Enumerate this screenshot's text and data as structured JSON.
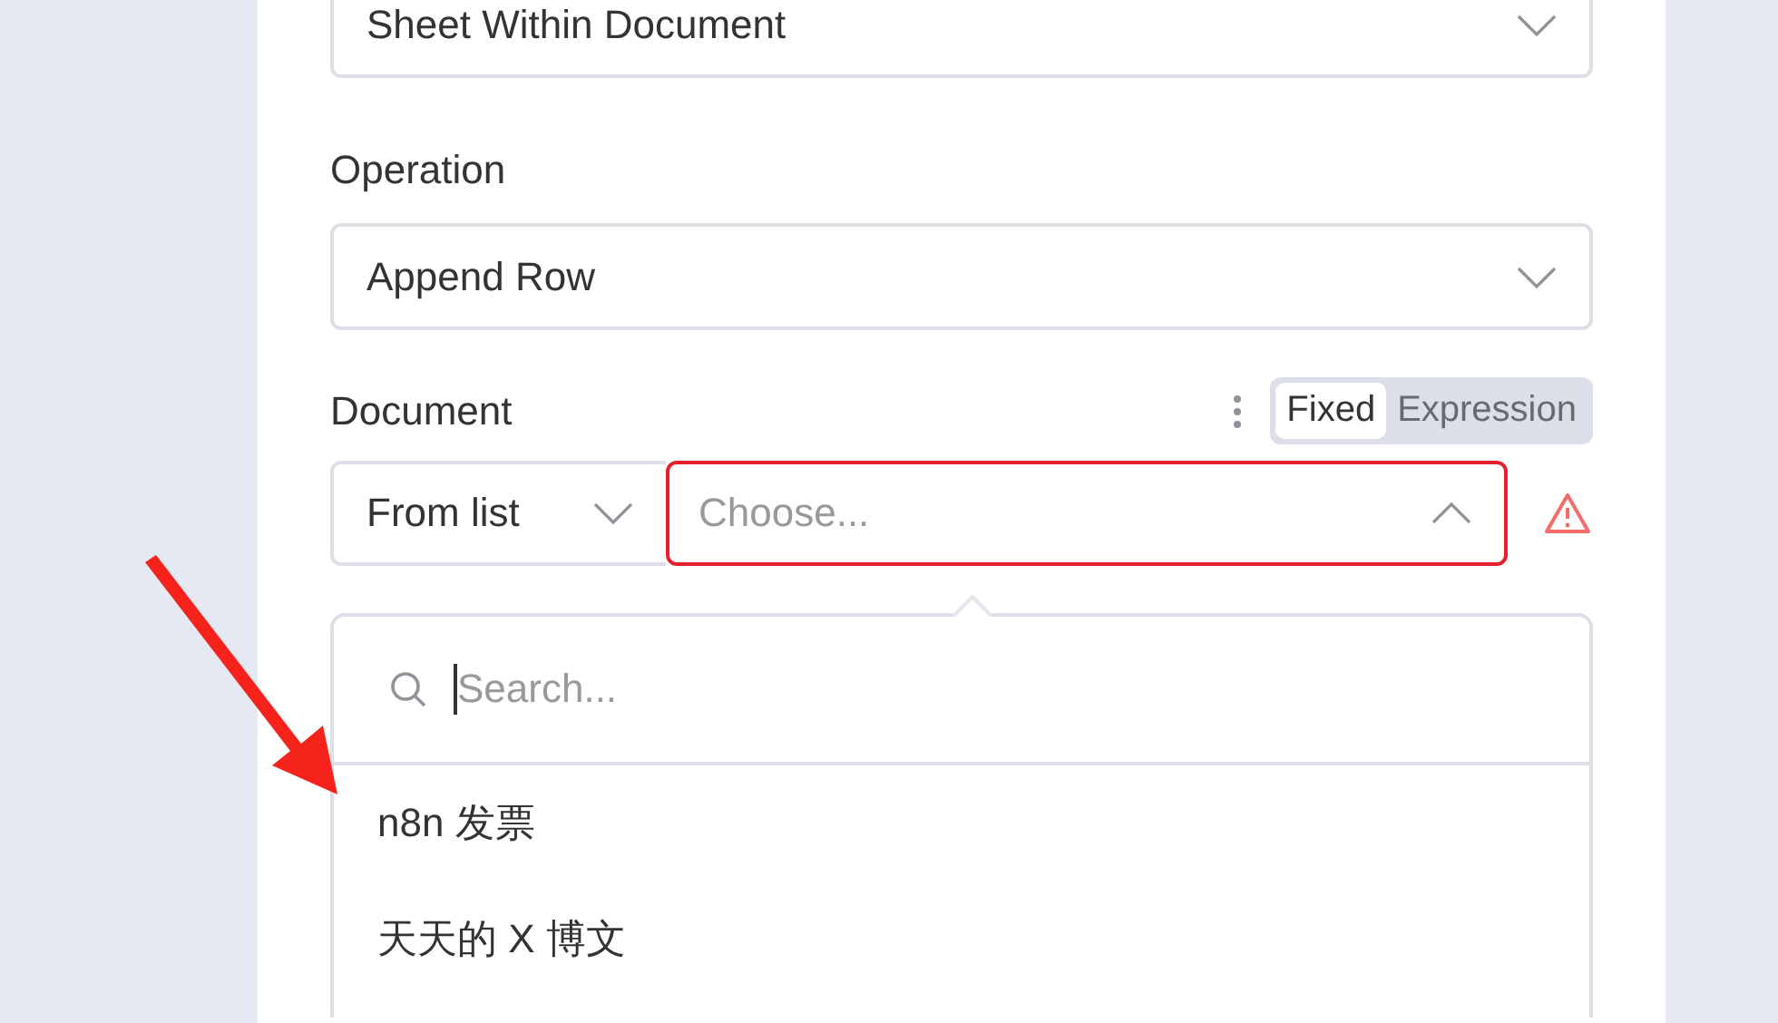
{
  "fields": [
    {
      "kind": "select",
      "value": "Sheet Within Document"
    },
    {
      "kind": "select",
      "label": "Operation",
      "value": "Append Row"
    }
  ],
  "document": {
    "label": "Document",
    "mode_toggle": [
      {
        "label": "Fixed",
        "selected": true
      },
      {
        "label": "Expression",
        "selected": false
      }
    ],
    "source": {
      "value": "From list"
    },
    "picker": {
      "placeholder": "Choose...",
      "expanded": true,
      "error": true
    },
    "dropdown": {
      "search": {
        "placeholder": "Search...",
        "focused": true
      },
      "items": [
        {
          "label": "n8n 发票"
        },
        {
          "label": "天天的 X 博文"
        }
      ]
    }
  }
}
